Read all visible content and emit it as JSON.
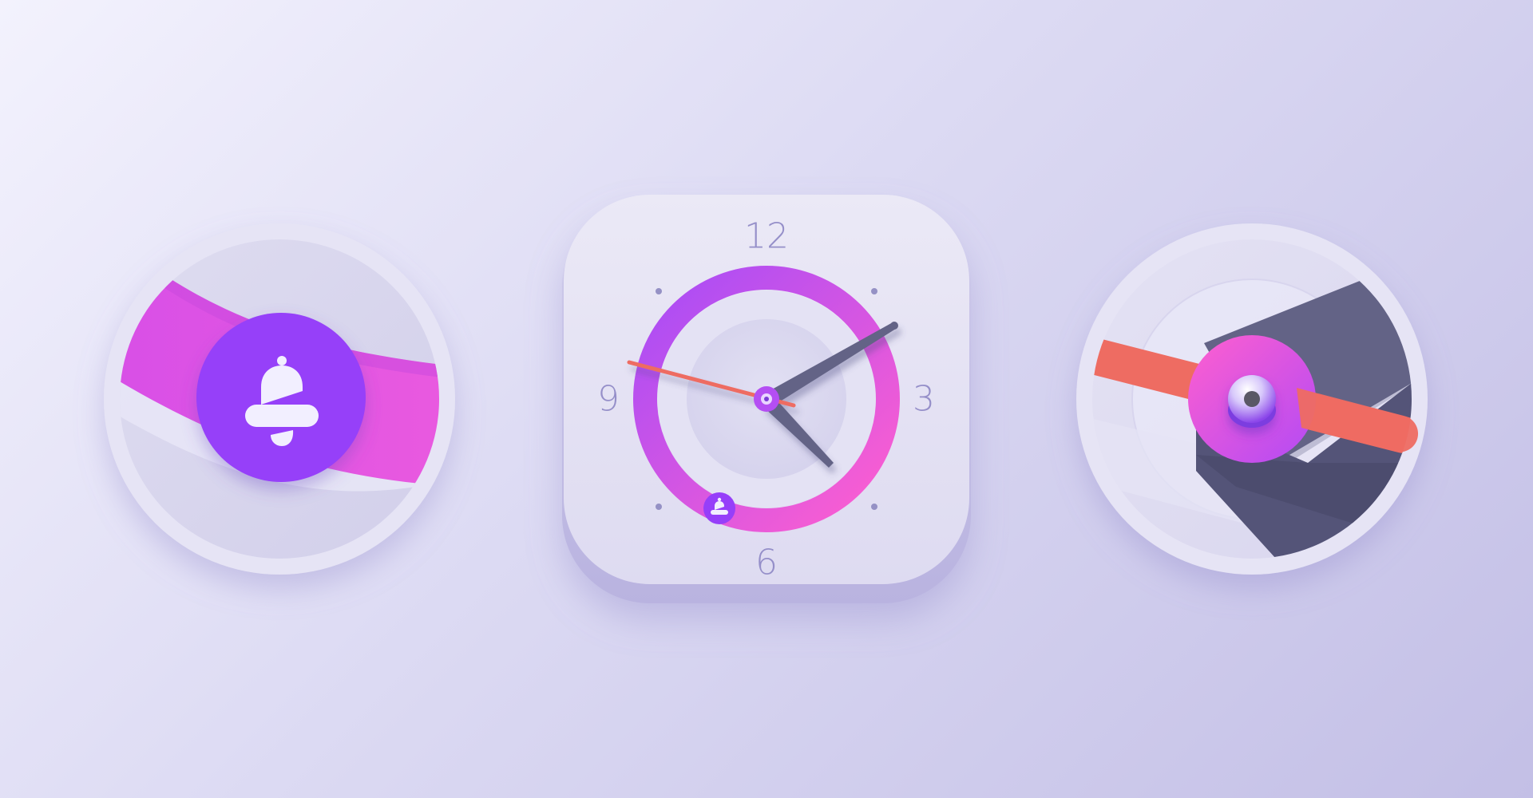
{
  "colors": {
    "background_top": "#f3f2fd",
    "background_bottom": "#c3bfe6",
    "tile_face": "#e7e5f5",
    "ring_start": "#a74cf7",
    "ring_end": "#ff5fcf",
    "purple_button": "#963ff9",
    "pink_button": "#f15bd9",
    "coral_hand": "#ee6c62",
    "slate_hand": "#636386",
    "numeral": "#958fc9",
    "tick_dot": "#9591c5"
  },
  "icons": {
    "left_badge": "bell-icon",
    "ring_marker": "bell-icon",
    "center_pin": "pin-icon"
  },
  "clock_face": {
    "numerals": {
      "top": "12",
      "right": "3",
      "bottom": "6",
      "left": "9"
    }
  }
}
